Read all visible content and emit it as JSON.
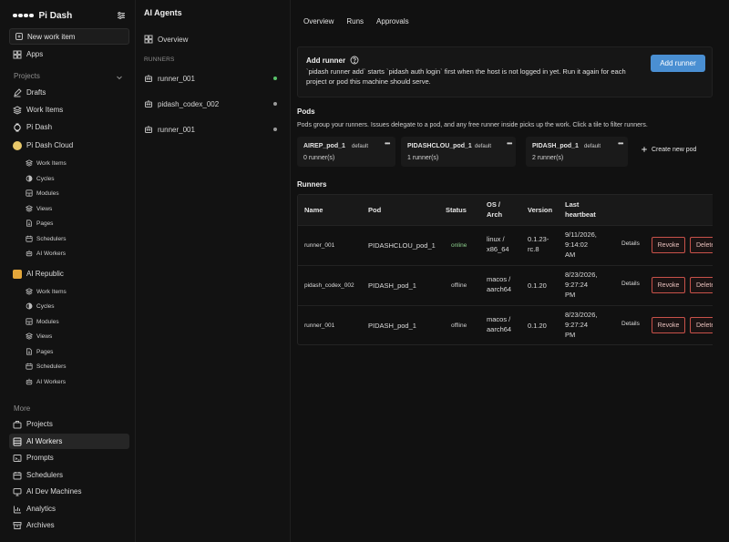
{
  "app": {
    "name": "Pi Dash",
    "new_work_item": "New work item",
    "apps": "Apps"
  },
  "sidebar": {
    "projects_label": "Projects",
    "top_items": [
      "Drafts",
      "Work Items",
      "Pi Dash"
    ],
    "projects": [
      {
        "name": "Pi Dash Cloud",
        "items": [
          "Work Items",
          "Cycles",
          "Modules",
          "Views",
          "Pages",
          "Schedulers",
          "AI Workers"
        ]
      },
      {
        "name": "AI Republic",
        "items": [
          "Work Items",
          "Cycles",
          "Modules",
          "Views",
          "Pages",
          "Schedulers",
          "AI Workers"
        ]
      }
    ],
    "more_label": "More",
    "more_items": [
      "Projects",
      "AI Workers",
      "Prompts",
      "Schedulers",
      "AI Dev Machines",
      "Analytics",
      "Archives"
    ],
    "active_item": "AI Workers"
  },
  "agents_panel": {
    "title": "AI Agents",
    "overview": "Overview",
    "runners_heading": "RUNNERS",
    "runners": [
      {
        "name": "runner_001",
        "status": "online"
      },
      {
        "name": "pidash_codex_002",
        "status": "offline"
      },
      {
        "name": "runner_001",
        "status": "offline"
      }
    ]
  },
  "main": {
    "tabs": [
      "Overview",
      "Runs",
      "Approvals"
    ],
    "add_runner": {
      "title": "Add runner",
      "description": "`pidash runner add` starts `pidash auth login` first when the host is not logged in yet. Run it again for each project or pod this machine should serve.",
      "button": "Add runner"
    },
    "pods": {
      "heading": "Pods",
      "description": "Pods group your runners. Issues delegate to a pod, and any free runner inside picks up the work. Click a tile to filter runners.",
      "items": [
        {
          "name": "AIREP_pod_1",
          "badge": "default",
          "count": "0 runner(s)"
        },
        {
          "name": "PIDASHCLOU_pod_1",
          "badge": "default",
          "count": "1 runner(s)"
        },
        {
          "name": "PIDASH_pod_1",
          "badge": "default",
          "count": "2 runner(s)"
        }
      ],
      "more": "•••",
      "create": "Create new pod"
    },
    "runners": {
      "heading": "Runners",
      "columns": {
        "name": "Name",
        "pod": "Pod",
        "status": "Status",
        "os_1": "OS /",
        "os_2": "Arch",
        "version": "Version",
        "hb_1": "Last",
        "hb_2": "heartbeat"
      },
      "rows": [
        {
          "name": "runner_001",
          "pod": "PIDASHCLOU_pod_1",
          "status": "online",
          "os": "linux /",
          "arch": "x86_64",
          "version": "0.1.23-",
          "version2": "rc.8",
          "hb1": "9/11/2026,",
          "hb2": "9:14:02",
          "hb3": "AM",
          "details": "Details",
          "revoke": "Revoke",
          "delete": "Delete"
        },
        {
          "name": "pidash_codex_002",
          "pod": "PIDASH_pod_1",
          "status": "offline",
          "os": "macos /",
          "arch": "aarch64",
          "version": "0.1.20",
          "version2": "",
          "hb1": "8/23/2026,",
          "hb2": "9:27:24",
          "hb3": "PM",
          "details": "Details",
          "revoke": "Revoke",
          "delete": "Delete"
        },
        {
          "name": "runner_001",
          "pod": "PIDASH_pod_1",
          "status": "offline",
          "os": "macos /",
          "arch": "aarch64",
          "version": "0.1.20",
          "version2": "",
          "hb1": "8/23/2026,",
          "hb2": "9:27:24",
          "hb3": "PM",
          "details": "Details",
          "revoke": "Revoke",
          "delete": "Delete"
        }
      ]
    }
  },
  "colors": {
    "accent": "#4a8fd2",
    "online_dot": "#59c26a",
    "offline_dot": "#9a9a9a",
    "danger": "#c9524a"
  }
}
